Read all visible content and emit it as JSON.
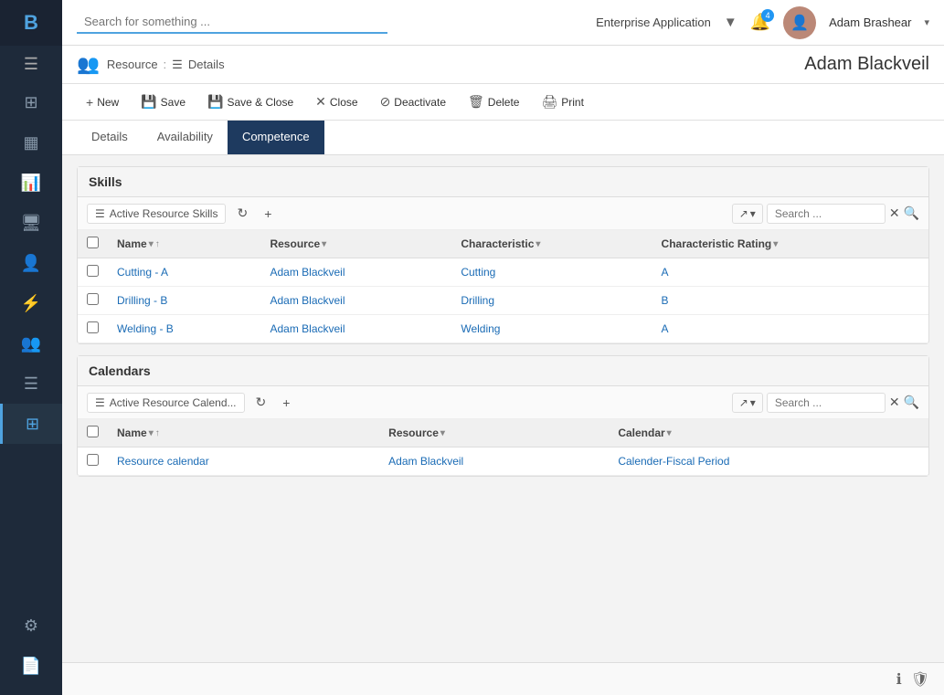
{
  "app": {
    "logo": "B",
    "enterprise_label": "Enterprise Application",
    "search_placeholder": "Search for something ..."
  },
  "user": {
    "name": "Adam Brashear",
    "notification_count": "4"
  },
  "page": {
    "resource_label": "Resource",
    "breadcrumb_sep": ":",
    "details_label": "Details",
    "record_name": "Adam Blackveil"
  },
  "toolbar": {
    "new_label": "New",
    "save_label": "Save",
    "save_close_label": "Save & Close",
    "close_label": "Close",
    "deactivate_label": "Deactivate",
    "delete_label": "Delete",
    "print_label": "Print"
  },
  "tabs": [
    {
      "id": "details",
      "label": "Details",
      "active": false
    },
    {
      "id": "availability",
      "label": "Availability",
      "active": false
    },
    {
      "id": "competence",
      "label": "Competence",
      "active": true
    }
  ],
  "skills_section": {
    "title": "Skills",
    "view_label": "Active Resource Skills",
    "search_placeholder": "Search ...",
    "columns": [
      "Name",
      "Resource",
      "Characteristic",
      "Characteristic Rating"
    ],
    "rows": [
      {
        "name": "Cutting - A",
        "resource": "Adam Blackveil",
        "characteristic": "Cutting",
        "rating": "A"
      },
      {
        "name": "Drilling - B",
        "resource": "Adam Blackveil",
        "characteristic": "Drilling",
        "rating": "B"
      },
      {
        "name": "Welding - B",
        "resource": "Adam Blackveil",
        "characteristic": "Welding",
        "rating": "A"
      }
    ]
  },
  "calendars_section": {
    "title": "Calendars",
    "view_label": "Active Resource Calend...",
    "search_placeholder": "Search ...",
    "columns": [
      "Name",
      "Resource",
      "Calendar"
    ],
    "rows": [
      {
        "name": "Resource calendar",
        "resource": "Adam Blackveil",
        "calendar": "Calender-Fiscal Period"
      }
    ]
  },
  "sidebar": {
    "items": [
      {
        "id": "dashboard",
        "icon": "⊞",
        "active": false
      },
      {
        "id": "calendar",
        "icon": "📅",
        "active": false
      },
      {
        "id": "chart",
        "icon": "📊",
        "active": false
      },
      {
        "id": "monitor",
        "icon": "🖥",
        "active": false
      },
      {
        "id": "user",
        "icon": "👤",
        "active": false
      },
      {
        "id": "flow",
        "icon": "⚡",
        "active": false
      },
      {
        "id": "group",
        "icon": "👥",
        "active": false
      },
      {
        "id": "list",
        "icon": "☰",
        "active": false
      },
      {
        "id": "grid",
        "icon": "⊞",
        "active": true
      },
      {
        "id": "settings",
        "icon": "⚙",
        "active": false
      },
      {
        "id": "docs",
        "icon": "📄",
        "active": false
      }
    ]
  }
}
